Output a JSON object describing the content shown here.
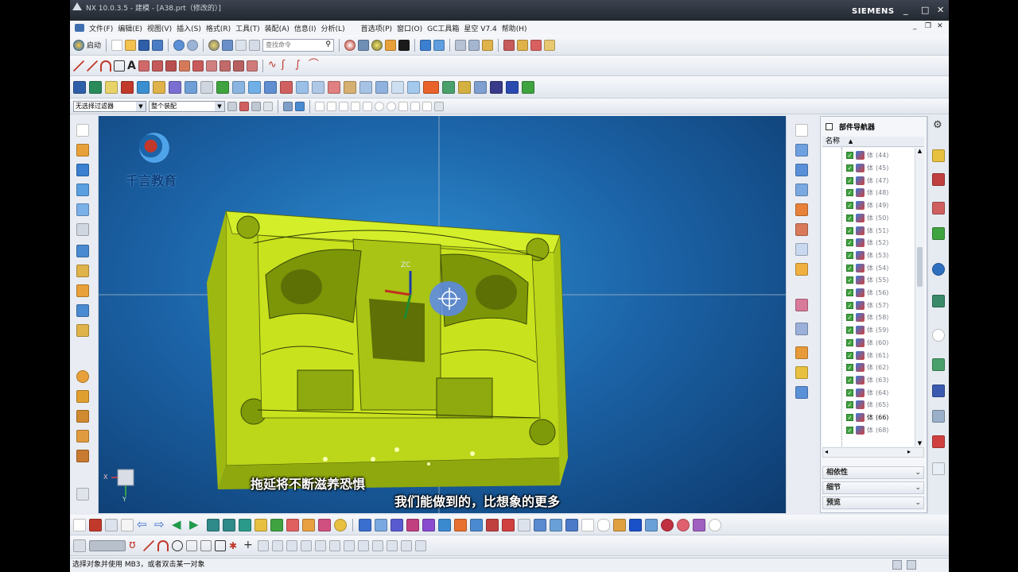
{
  "app": {
    "title": "NX 10.0.3.5 - 建模 - [A38.prt（修改的）]",
    "brand": "SIEMENS",
    "window_buttons": [
      "_",
      "□",
      "✕"
    ],
    "doc_buttons": [
      "_",
      "❐",
      "✕"
    ]
  },
  "menu": [
    "文件(F)",
    "编辑(E)",
    "视图(V)",
    "插入(S)",
    "格式(R)",
    "工具(T)",
    "装配(A)",
    "信息(I)",
    "分析(L)",
    "首选项(P)",
    "窗口(O)",
    "GC工具箱",
    "星空 V7.4",
    "帮助(H)"
  ],
  "toolbar1": {
    "start_label": "启动",
    "search_placeholder": "查找命令"
  },
  "selection_bar": {
    "filter_value": "无选择过滤器",
    "scope_value": "整个装配"
  },
  "watermark": {
    "logo_text": "千言教育"
  },
  "viewport": {
    "axis_label": "ZC",
    "triad_labels": [
      "X",
      "Y"
    ],
    "subtitle_line1": "拖延将不断滋养恐惧",
    "subtitle_line2": "我们能做到的，比想象的更多"
  },
  "navigator": {
    "title": "部件导航器",
    "column_name": "名称",
    "body_label": "体",
    "bodies": [
      "(44)",
      "(45)",
      "(47)",
      "(48)",
      "(49)",
      "(50)",
      "(51)",
      "(52)",
      "(53)",
      "(54)",
      "(55)",
      "(56)",
      "(57)",
      "(58)",
      "(59)",
      "(60)",
      "(61)",
      "(62)",
      "(63)",
      "(64)",
      "(65)",
      "(66)",
      "(68)"
    ],
    "highlighted_body": "(66)",
    "sections": [
      "相依性",
      "细节",
      "预览"
    ]
  },
  "status": {
    "text": "选择对象并使用 MB3，或者双击某一对象"
  },
  "colors": {
    "accent": "#1e6fc0",
    "model": "#c7e21c",
    "viewport_bg": "#1c64a8"
  },
  "toolbar_row2_icons": [
    "line-icon",
    "arc-icon",
    "rectangle-icon",
    "text-icon",
    "fillet-icon"
  ]
}
